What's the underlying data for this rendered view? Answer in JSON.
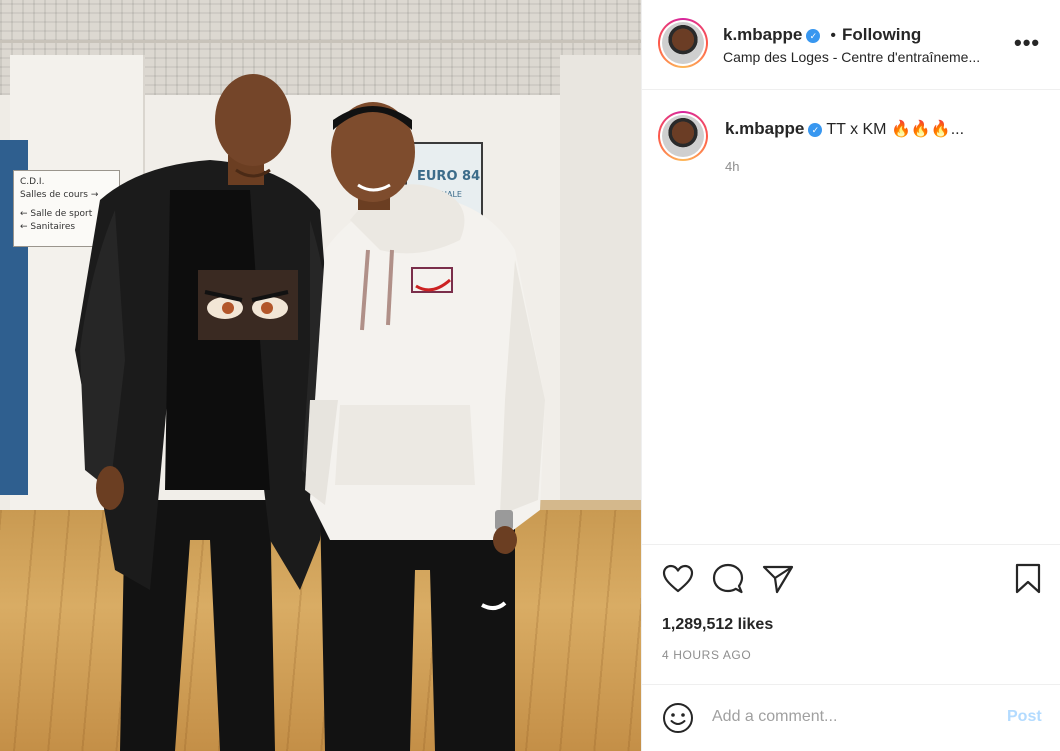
{
  "photo": {
    "sign_lines": [
      "C.D.I.",
      "Salles de cours →",
      "← Salle de sport",
      "← Sanitaires"
    ],
    "poster_title": "EURO 84",
    "poster_sub": "NALE"
  },
  "header": {
    "username": "k.mbappe",
    "verified_mark": "✓",
    "separator": "•",
    "follow_status": "Following",
    "location": "Camp des Loges - Centre d'entraîneme...",
    "more_icon": "•••"
  },
  "caption": {
    "username": "k.mbappe",
    "verified_mark": "✓",
    "text": "TT x KM 🔥🔥🔥...",
    "time": "4h"
  },
  "actions": {
    "icons": [
      "heart-icon",
      "comment-icon",
      "share-icon",
      "bookmark-icon"
    ]
  },
  "stats": {
    "likes": "1,289,512 likes",
    "timestamp": "4 HOURS AGO"
  },
  "comment": {
    "placeholder": "Add a comment...",
    "post_label": "Post"
  },
  "colors": {
    "verified": "#3897f0",
    "post_disabled": "#b3dbff",
    "muted": "#8e8e8e"
  }
}
